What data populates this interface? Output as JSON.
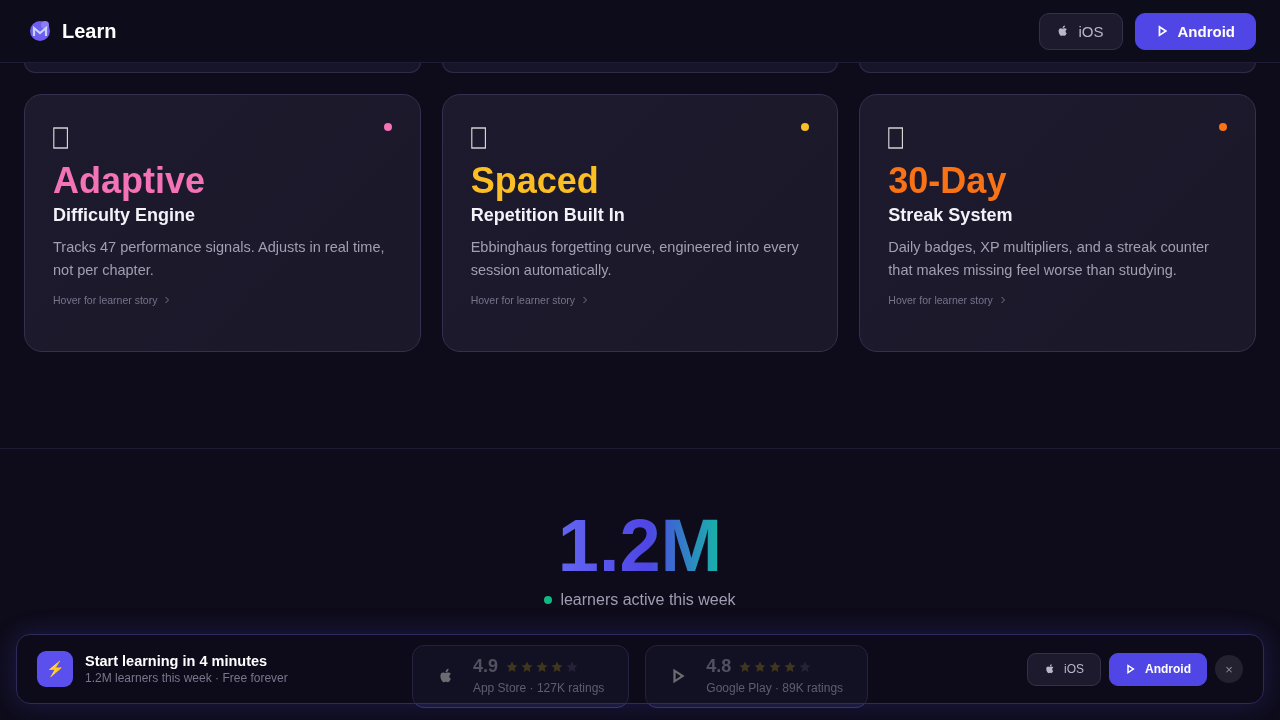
{
  "header": {
    "brand": "Learn",
    "buttons": [
      {
        "label": "iOS",
        "kind": "ios",
        "selected": false
      },
      {
        "label": "Android",
        "kind": "android",
        "selected": true
      }
    ]
  },
  "features": [
    {
      "highlight": "Adaptive",
      "title": "Difficulty Engine",
      "text": "Tracks 47 performance signals. Adjusts in real time, not per chapter.",
      "link": "Hover for learner story",
      "color": "#f472b6"
    },
    {
      "highlight": "Spaced",
      "title": "Repetition Built In",
      "text": "Ebbinghaus forgetting curve, engineered into every session automatically.",
      "link": "Hover for learner story",
      "color": "#fbbf24"
    },
    {
      "highlight": "30-Day",
      "title": "Streak System",
      "text": "Daily badges, XP multipliers, and a streak counter that makes missing feel worse than studying.",
      "link": "Hover for learner story",
      "color": "#f97316"
    }
  ],
  "stat": {
    "value": "1.2M",
    "label": "learners active this week"
  },
  "ratings": [
    {
      "kind": "ios",
      "score": "4.9",
      "stars": 4,
      "caption": "App Store · 127K ratings"
    },
    {
      "kind": "android",
      "score": "4.8",
      "stars": 4,
      "caption": "Google Play · 89K ratings"
    }
  ],
  "banner": {
    "icon": "⚡",
    "title": "Start learning in 4 minutes",
    "subtitle": "1.2M learners this week · Free forever",
    "buttons": [
      {
        "label": "iOS",
        "kind": "ios",
        "selected": false
      },
      {
        "label": "Android",
        "kind": "android",
        "selected": true
      }
    ],
    "close": "×"
  }
}
